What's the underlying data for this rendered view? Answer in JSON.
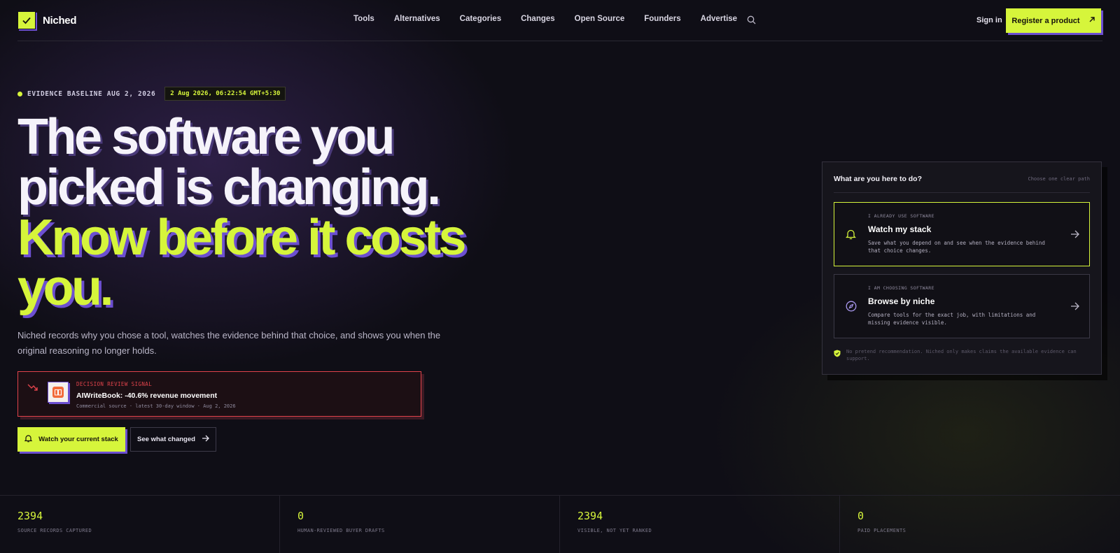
{
  "nav": {
    "brand": "Niched",
    "links": [
      "Tools",
      "Alternatives",
      "Categories",
      "Changes",
      "Open Source",
      "Founders",
      "Advertise"
    ],
    "signin": "Sign in",
    "register": "Register a product"
  },
  "hero": {
    "baseline_label": "EVIDENCE BASELINE AUG 2, 2026",
    "timestamp": "2 Aug 2026, 06:22:54 GMT+5:30",
    "headline_1": "The software you",
    "headline_2": "picked is changing.",
    "headline_3": "Know before it costs you.",
    "subtitle": "Niched records why you chose a tool, watches the evidence behind that choice, and shows you when the original reasoning no longer holds.",
    "signal": {
      "kicker": "DECISION REVIEW SIGNAL",
      "title": "AIWriteBook: -40.6% revenue movement",
      "meta": "Commercial source · latest 30-day window · Aug 2, 2026"
    },
    "primary_cta": "Watch your current stack",
    "secondary_cta": "See what changed"
  },
  "panel": {
    "heading": "What are you here to do?",
    "hint": "Choose one clear path",
    "options": [
      {
        "kicker": "I ALREADY USE SOFTWARE",
        "title": "Watch my stack",
        "desc": "Save what you depend on and see when the evidence behind that choice changes."
      },
      {
        "kicker": "I AM CHOOSING SOFTWARE",
        "title": "Browse by niche",
        "desc": "Compare tools for the exact job, with limitations and missing evidence visible."
      }
    ],
    "note": "No pretend recommendation. Niched only makes claims the available evidence can support."
  },
  "stats": [
    {
      "value": "2394",
      "label": "SOURCE RECORDS CAPTURED"
    },
    {
      "value": "0",
      "label": "HUMAN-REVIEWED BUYER DRAFTS"
    },
    {
      "value": "2394",
      "label": "VISIBLE, NOT YET RANKED"
    },
    {
      "value": "0",
      "label": "PAID PLACEMENTS"
    }
  ],
  "colors": {
    "accent": "#d6f53b",
    "shadow_purple": "#6c4fd1",
    "alert_red": "#e0434b",
    "background": "#0f0e16"
  }
}
